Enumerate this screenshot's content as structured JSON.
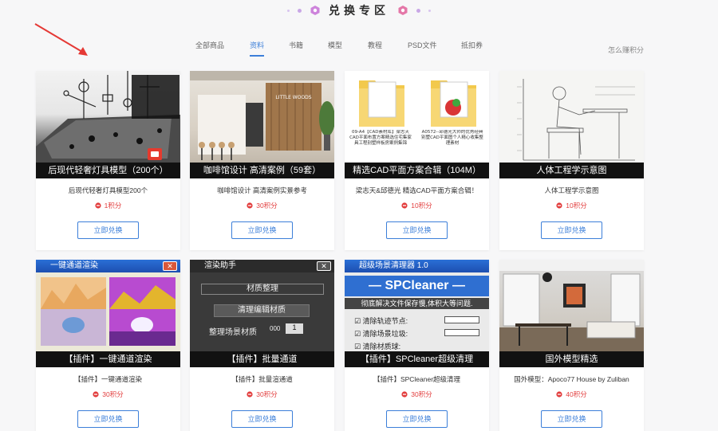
{
  "header": {
    "title": "兑换专区"
  },
  "tabs": [
    {
      "label": "全部商品"
    },
    {
      "label": "资料"
    },
    {
      "label": "书籍"
    },
    {
      "label": "模型"
    },
    {
      "label": "教程"
    },
    {
      "label": "PSD文件"
    },
    {
      "label": "抵扣券"
    }
  ],
  "earn_link": "怎么赚积分",
  "cards": [
    {
      "caption": "后现代轻奢灯具模型（200个）",
      "desc": "后现代轻奢灯具模型200个",
      "points": "1积分",
      "button": "立即兑换"
    },
    {
      "caption": "咖啡馆设计 高清案例（59套）",
      "desc": "咖啡馆设计 高清案例实景参考",
      "points": "30积分",
      "button": "立即兑换"
    },
    {
      "caption": "精选CAD平面方案合辑（104M）",
      "desc": "梁志天&邱德光 精选CAD平面方案合辑！",
      "points": "10积分",
      "button": "立即兑换"
    },
    {
      "caption": "人体工程学示意图",
      "desc": "人体工程学示意图",
      "points": "10积分",
      "button": "立即兑换"
    },
    {
      "caption": "【插件】一键通道渲染",
      "desc": "【插件】一键通道渲染",
      "points": "30积分",
      "button": "立即兑换"
    },
    {
      "caption": "【插件】批量通道",
      "desc": "【插件】批量渲通道",
      "points": "30积分",
      "button": "立即兑换"
    },
    {
      "caption": "【插件】SPCleaner超级清理",
      "desc": "【插件】SPCleaner超级清理",
      "points": "30积分",
      "button": "立即兑换"
    },
    {
      "caption": "国外模型精选",
      "desc": "国外模型：Apoco77 House by Zuliban",
      "points": "40积分",
      "button": "立即兑换"
    }
  ],
  "thumbs": {
    "cafe_sign": "LITTLE WOODS",
    "cad_file_1": "09-A4【CAD素材库】梁志天CAD平面布置方案精选住宅集家具工程别墅样板房案例集锦",
    "cad_file_2": "A0572--邱德光大师的优秀经典别墅CAD平面图个人精心收集整理素材",
    "render_title": "一键通道渲染",
    "helper_title": "渲染助手",
    "helper_section": "材质整理",
    "helper_btn": "清理编辑材质",
    "helper_row": "整理场景材质",
    "helper_num1": "000",
    "helper_num2": "1",
    "sp_title": "超级场景清理器 1.0",
    "sp_brand": "SPCleaner",
    "sp_tagline": "彻底解决文件保存慢,体积大等问题.",
    "sp_opt1": "清除轨迹节点:",
    "sp_opt2": "清除场景垃圾:",
    "sp_opt3": "清除材质球:"
  },
  "colors": {
    "accent": "#3c7fd9",
    "points": "#e23d3d",
    "arrow": "#e53935"
  },
  "icons": {
    "header": "hexagon-icon",
    "points": "ban-circle-icon",
    "annotation": "red-arrow-icon"
  }
}
